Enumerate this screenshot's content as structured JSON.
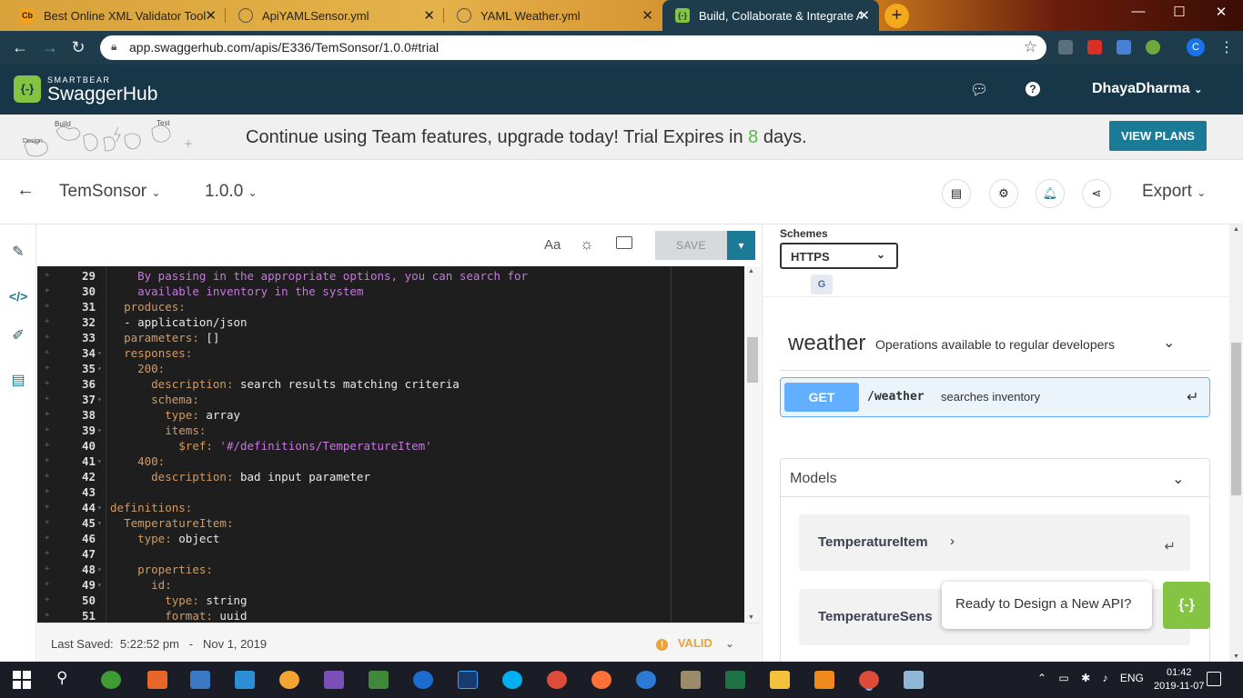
{
  "browser": {
    "tabs": [
      {
        "title": "Best Online XML Validator Tool",
        "favicon": "Cb"
      },
      {
        "title": "ApiYAMLSensor.yml",
        "favicon": "globe"
      },
      {
        "title": "YAML Weather.yml",
        "favicon": "globe"
      },
      {
        "title": "Build, Collaborate & Integrate AP",
        "favicon": "{-}"
      }
    ],
    "url": "app.swaggerhub.com/apis/E336/TemSonsor/1.0.0#trial",
    "profile_initial": "C"
  },
  "header": {
    "brand_small": "SMARTBEAR",
    "brand": "SwaggerHub",
    "logo": "{-}",
    "user": "DhayaDharma"
  },
  "banner": {
    "art_build": "Build",
    "art_test": "Test",
    "art_design": "Design",
    "text_before": "Continue using Team features, upgrade today! Trial Expires in ",
    "days": "8",
    "text_after": " days.",
    "button": "VIEW PLANS"
  },
  "api": {
    "name": "TemSonsor",
    "version": "1.0.0",
    "export": "Export"
  },
  "editor": {
    "font_toggle": "Aa",
    "save": "SAVE",
    "last_saved_label": "Last Saved:",
    "last_saved_time": "5:22:52 pm",
    "last_saved_sep": "-",
    "last_saved_date": "Nov 1, 2019",
    "status": "VALID",
    "lines": [
      {
        "n": "29",
        "indent": "    ",
        "key": "",
        "val": "",
        "str": "By passing in the appropriate options, you can search for",
        "fold": false
      },
      {
        "n": "30",
        "indent": "    ",
        "key": "",
        "val": "",
        "str": "available inventory in the system",
        "fold": false
      },
      {
        "n": "31",
        "indent": "  ",
        "key": "produces:",
        "val": "",
        "str": "",
        "fold": false
      },
      {
        "n": "32",
        "indent": "  ",
        "key": "",
        "val": "- application/json",
        "str": "",
        "fold": false
      },
      {
        "n": "33",
        "indent": "  ",
        "key": "parameters:",
        "val": " []",
        "str": "",
        "fold": false
      },
      {
        "n": "34",
        "indent": "  ",
        "key": "responses:",
        "val": "",
        "str": "",
        "fold": true
      },
      {
        "n": "35",
        "indent": "    ",
        "key": "200:",
        "val": "",
        "str": "",
        "fold": true
      },
      {
        "n": "36",
        "indent": "      ",
        "key": "description:",
        "val": " search results matching criteria",
        "str": "",
        "fold": false
      },
      {
        "n": "37",
        "indent": "      ",
        "key": "schema:",
        "val": "",
        "str": "",
        "fold": true
      },
      {
        "n": "38",
        "indent": "        ",
        "key": "type:",
        "val": " array",
        "str": "",
        "fold": false
      },
      {
        "n": "39",
        "indent": "        ",
        "key": "items:",
        "val": "",
        "str": "",
        "fold": true
      },
      {
        "n": "40",
        "indent": "          ",
        "key": "$ref:",
        "val": "",
        "str": " '#/definitions/TemperatureItem'",
        "fold": false
      },
      {
        "n": "41",
        "indent": "    ",
        "key": "400:",
        "val": "",
        "str": "",
        "fold": true
      },
      {
        "n": "42",
        "indent": "      ",
        "key": "description:",
        "val": " bad input parameter",
        "str": "",
        "fold": false
      },
      {
        "n": "43",
        "indent": "",
        "key": "",
        "val": "",
        "str": "",
        "fold": false
      },
      {
        "n": "44",
        "indent": "",
        "key": "definitions:",
        "val": "",
        "str": "",
        "fold": true
      },
      {
        "n": "45",
        "indent": "  ",
        "key": "TemperatureItem:",
        "val": "",
        "str": "",
        "fold": true
      },
      {
        "n": "46",
        "indent": "    ",
        "key": "type:",
        "val": " object",
        "str": "",
        "fold": false
      },
      {
        "n": "47",
        "indent": "",
        "key": "",
        "val": "",
        "str": "",
        "fold": false
      },
      {
        "n": "48",
        "indent": "    ",
        "key": "properties:",
        "val": "",
        "str": "",
        "fold": true
      },
      {
        "n": "49",
        "indent": "      ",
        "key": "id:",
        "val": "",
        "str": "",
        "fold": true
      },
      {
        "n": "50",
        "indent": "        ",
        "key": "type:",
        "val": " string",
        "str": "",
        "fold": false
      },
      {
        "n": "51",
        "indent": "        ",
        "key": "format:",
        "val": " uuid",
        "str": "",
        "fold": false
      }
    ]
  },
  "docs": {
    "schemes_label": "Schemes",
    "scheme": "HTTPS",
    "tag": "weather",
    "tag_description": "Operations available to regular developers",
    "operation": {
      "method": "GET",
      "path": "/weather",
      "summary": "searches inventory"
    },
    "models_title": "Models",
    "models": [
      "TemperatureItem",
      "TemperatureSens"
    ]
  },
  "popup": {
    "text": "Ready to Design a New API?",
    "button": "{-}"
  },
  "taskbar": {
    "lang": "ENG",
    "time": "01:42",
    "date": "2019-11-07"
  }
}
